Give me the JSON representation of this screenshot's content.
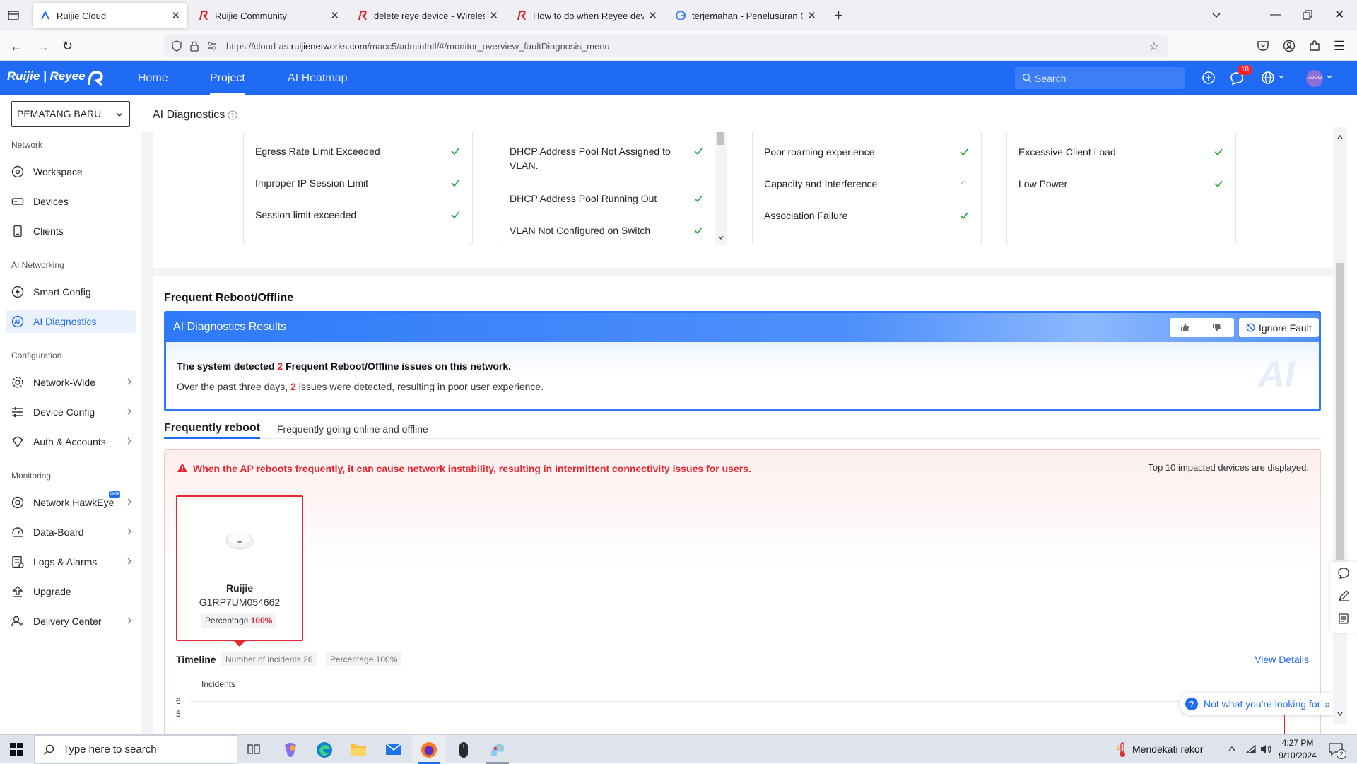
{
  "browser": {
    "tabs": [
      {
        "title": "Ruijie Cloud",
        "active": true
      },
      {
        "title": "Ruijie Community",
        "active": false
      },
      {
        "title": "delete reye device - Wireless - R",
        "active": false
      },
      {
        "title": "How to do when Reyee devices",
        "active": false
      },
      {
        "title": "terjemahan - Penelusuran Goog",
        "active": false
      }
    ],
    "url_prefix": "https://cloud-as.",
    "url_domain": "ruijienetworks.com",
    "url_path": "/macc5/adminIntl/#/monitor_overview_faultDiagnosis_menu"
  },
  "header": {
    "logo": "Ruijie | Reyee",
    "nav": [
      {
        "label": "Home",
        "active": false
      },
      {
        "label": "Project",
        "active": true
      },
      {
        "label": "AI Heatmap",
        "active": false
      }
    ],
    "search_placeholder": "Search",
    "notification_count": "18",
    "avatar_text": "LOGO",
    "brand_color": "#1f6bf5"
  },
  "sidebar": {
    "project": "PEMATANG BARU",
    "sections": [
      {
        "title": "Network",
        "items": [
          {
            "label": "Workspace",
            "icon": "compass-icon",
            "chevron": false
          },
          {
            "label": "Devices",
            "icon": "device-icon",
            "chevron": false
          },
          {
            "label": "Clients",
            "icon": "phone-icon",
            "chevron": false
          }
        ]
      },
      {
        "title": "AI Networking",
        "items": [
          {
            "label": "Smart Config",
            "icon": "smart-config-icon",
            "chevron": false
          },
          {
            "label": "AI Diagnostics",
            "icon": "ai-diagnostics-icon",
            "chevron": false,
            "active": true
          }
        ]
      },
      {
        "title": "Configuration",
        "items": [
          {
            "label": "Network-Wide",
            "icon": "gear-icon",
            "chevron": true
          },
          {
            "label": "Device Config",
            "icon": "sliders-icon",
            "chevron": true
          },
          {
            "label": "Auth & Accounts",
            "icon": "shield-icon",
            "chevron": true
          }
        ]
      },
      {
        "title": "Monitoring",
        "items": [
          {
            "label": "Network HawkEye",
            "icon": "eye-icon",
            "chevron": true,
            "badge": "Beta"
          },
          {
            "label": "Data-Board",
            "icon": "dashboard-icon",
            "chevron": true
          },
          {
            "label": "Logs & Alarms",
            "icon": "logs-icon",
            "chevron": true
          },
          {
            "label": "Upgrade",
            "icon": "upgrade-icon",
            "chevron": false
          },
          {
            "label": "Delivery Center",
            "icon": "delivery-icon",
            "chevron": true
          }
        ]
      }
    ]
  },
  "page": {
    "title": "AI Diagnostics",
    "cards": [
      {
        "items": [
          {
            "label": "Egress Rate Limit Exceeded",
            "status": "ok"
          },
          {
            "label": "Improper IP Session Limit",
            "status": "ok"
          },
          {
            "label": "Session limit exceeded",
            "status": "ok"
          }
        ]
      },
      {
        "items": [
          {
            "label": "DHCP Address Pool Not Assigned to VLAN.",
            "status": "ok"
          },
          {
            "label": "DHCP Address Pool Running Out",
            "status": "ok"
          },
          {
            "label": "VLAN Not Configured on Switch",
            "status": "ok"
          }
        ]
      },
      {
        "items": [
          {
            "label": "Poor roaming experience",
            "status": "ok"
          },
          {
            "label": "Capacity and Interference",
            "status": "loading"
          },
          {
            "label": "Association Failure",
            "status": "ok"
          }
        ]
      },
      {
        "items": [
          {
            "label": "Excessive Client Load",
            "status": "ok"
          },
          {
            "label": "Low Power",
            "status": "ok"
          }
        ]
      }
    ],
    "section_title": "Frequent Reboot/Offline",
    "results": {
      "header": "AI Diagnostics Results",
      "ignore_label": "Ignore Fault",
      "line1_pre": "The system detected ",
      "line1_count": "2",
      "line1_post": " Frequent Reboot/Offline issues on this network.",
      "line2_pre": "Over the past three days, ",
      "line2_count": "2",
      "line2_post": " issues were detected, resulting in poor user experience.",
      "watermark": "AI"
    },
    "tabs": [
      {
        "label": "Frequently reboot",
        "active": true
      },
      {
        "label": "Frequently going online and offline",
        "active": false
      }
    ],
    "warning": "When the AP reboots frequently, it can cause network instability, resulting in intermittent connectivity issues for users.",
    "top_note": "Top 10 impacted devices are displayed.",
    "device": {
      "brand": "Ruijie",
      "serial": "G1RP7UM054662",
      "percentage_label": "Percentage",
      "percentage_value": "100%"
    },
    "timeline": {
      "title": "Timeline",
      "incidents_tag": "Number of incidents 26",
      "percentage_tag": "Percentage 100%",
      "view_details": "View Details",
      "ylabel": "Incidents",
      "ytick_top": "6",
      "ytick_next": "5"
    },
    "help_bubble": "Not what you're looking for"
  },
  "taskbar": {
    "search_placeholder": "Type here to search",
    "weather": "Mendekati rekor",
    "time": "4:27 PM",
    "date": "9/10/2024",
    "notifications": "2"
  }
}
